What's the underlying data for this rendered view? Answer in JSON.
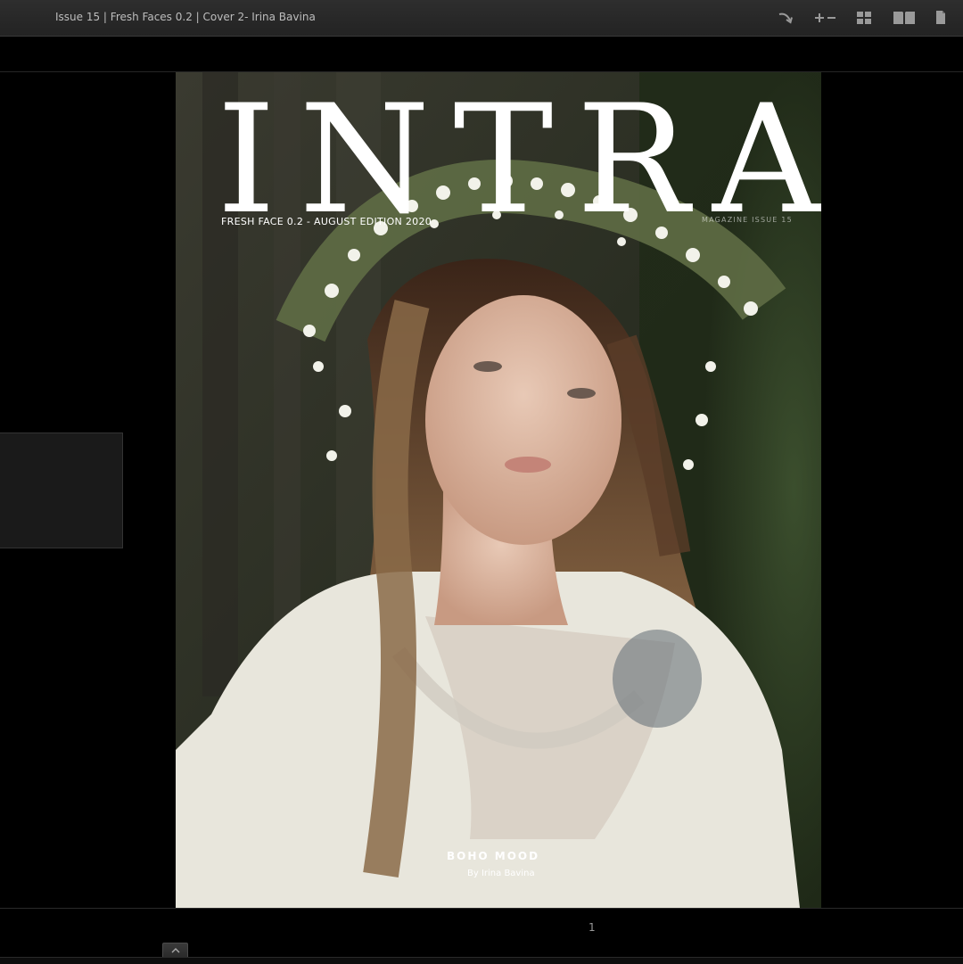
{
  "header": {
    "document_title": "Issue 15 | Fresh Faces 0.2 | Cover 2- Irina Bavina",
    "tools": [
      {
        "name": "share",
        "icon": "share-arrow-icon"
      },
      {
        "name": "zoom",
        "icon": "zoom-in-out-icon"
      },
      {
        "name": "grid-view",
        "icon": "grid-view-icon"
      },
      {
        "name": "double-page-view",
        "icon": "double-page-icon"
      },
      {
        "name": "single-page-view",
        "icon": "single-page-icon"
      }
    ]
  },
  "cover": {
    "masthead": "INTRA",
    "edition": "FRESH FACE 0.2 - AUGUST EDITION 2020",
    "issue": "MAGAZINE ISSUE 15",
    "story_title": "BOHO MOOD",
    "story_byline": "By Irina Bavina",
    "image": "cover-photo"
  },
  "footer": {
    "page_number": "1",
    "thumbnails_toggle_icon": "chevron-up-icon"
  },
  "colors": {
    "toolbar_bg": "#2a2a2a",
    "viewer_bg": "#000000",
    "masthead_text": "#ffffff"
  }
}
